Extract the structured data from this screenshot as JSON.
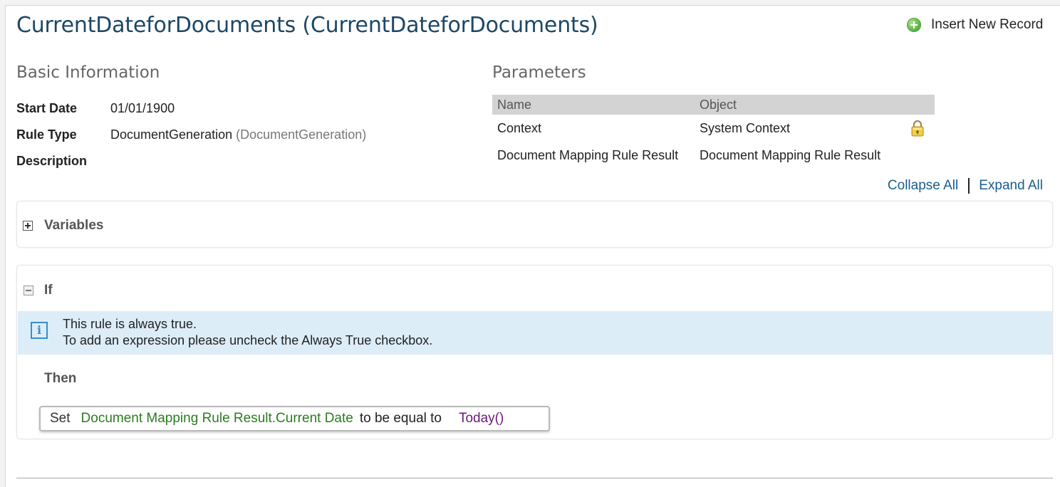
{
  "header": {
    "title": "CurrentDateforDocuments (CurrentDateforDocuments)",
    "insert_button_label": "Insert New Record"
  },
  "basic_info": {
    "heading": "Basic Information",
    "fields": [
      {
        "label": "Start Date",
        "value": "01/01/1900",
        "extra": ""
      },
      {
        "label": "Rule Type",
        "value": "DocumentGeneration",
        "extra": "(DocumentGeneration)"
      },
      {
        "label": "Description",
        "value": "",
        "extra": ""
      }
    ]
  },
  "parameters": {
    "heading": "Parameters",
    "columns": [
      "Name",
      "Object"
    ],
    "rows": [
      {
        "name": "Context",
        "object": "System Context",
        "locked": true
      },
      {
        "name": "Document Mapping Rule Result",
        "object": "Document Mapping Rule Result",
        "locked": false
      }
    ]
  },
  "links": {
    "collapse_all": "Collapse All",
    "expand_all": "Expand All"
  },
  "variables_section": {
    "title": "Variables",
    "expanded": false
  },
  "if_section": {
    "title": "If",
    "expanded": true,
    "info_line1": "This rule is always true.",
    "info_line2": "To add an expression please uncheck the Always True checkbox.",
    "then_label": "Then",
    "statement": {
      "keyword": "Set",
      "field": "Document Mapping Rule Result.Current Date",
      "operator": "to be equal to",
      "function": "Today()"
    }
  },
  "colors": {
    "title": "#1d4766",
    "link": "#1a5d8c",
    "field_green": "#2a7d1f",
    "function_purple": "#6a1a7a",
    "info_bg": "#dcedf8"
  },
  "icons": {
    "insert": "green-plus-circle-icon",
    "lock": "padlock-icon",
    "info": "info-icon"
  }
}
